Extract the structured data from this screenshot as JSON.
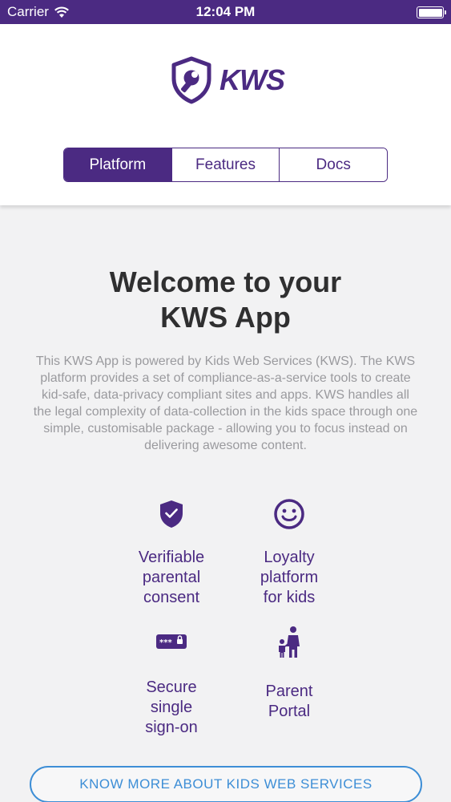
{
  "status_bar": {
    "carrier": "Carrier",
    "time": "12:04 PM",
    "battery_level": 1.0
  },
  "logo": {
    "text": "KWS",
    "icon": "shield-wrench-icon"
  },
  "tabs": [
    {
      "label": "Platform",
      "active": true
    },
    {
      "label": "Features",
      "active": false
    },
    {
      "label": "Docs",
      "active": false
    }
  ],
  "main": {
    "title_line1": "Welcome to your",
    "title_line2": "KWS App",
    "description": "This KWS App is powered by Kids Web Services (KWS). The KWS platform provides a set of compliance-as-a-service tools to create kid-safe, data-privacy compliant sites and apps. KWS handles all the legal complexity of data-collection in the kids space through one simple, customisable package - allowing you to focus instead on delivering awesome content."
  },
  "features": [
    {
      "label": "Verifiable\nparental\nconsent",
      "icon": "shield-check-icon"
    },
    {
      "label": "Loyalty\nplatform\nfor kids",
      "icon": "smiley-icon"
    },
    {
      "label": "Secure\nsingle\nsign-on",
      "icon": "password-lock-icon"
    },
    {
      "label": "Parent\nPortal",
      "icon": "parent-child-icon"
    }
  ],
  "cta": {
    "label": "KNOW MORE ABOUT KIDS WEB SERVICES"
  },
  "colors": {
    "brand": "#4b2a82",
    "link": "#3d8ed6",
    "background": "#f2f2f3",
    "muted_text": "#9a9a9e"
  }
}
